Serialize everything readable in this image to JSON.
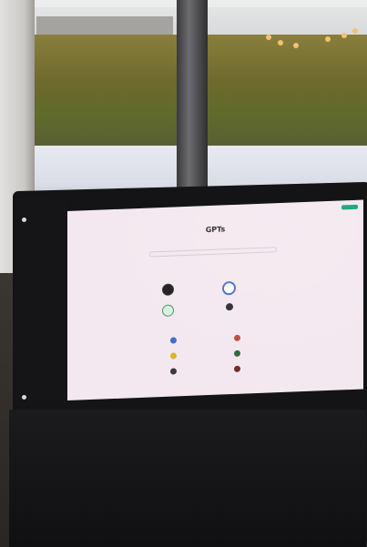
{
  "gpts": {
    "title": "GPTs"
  }
}
